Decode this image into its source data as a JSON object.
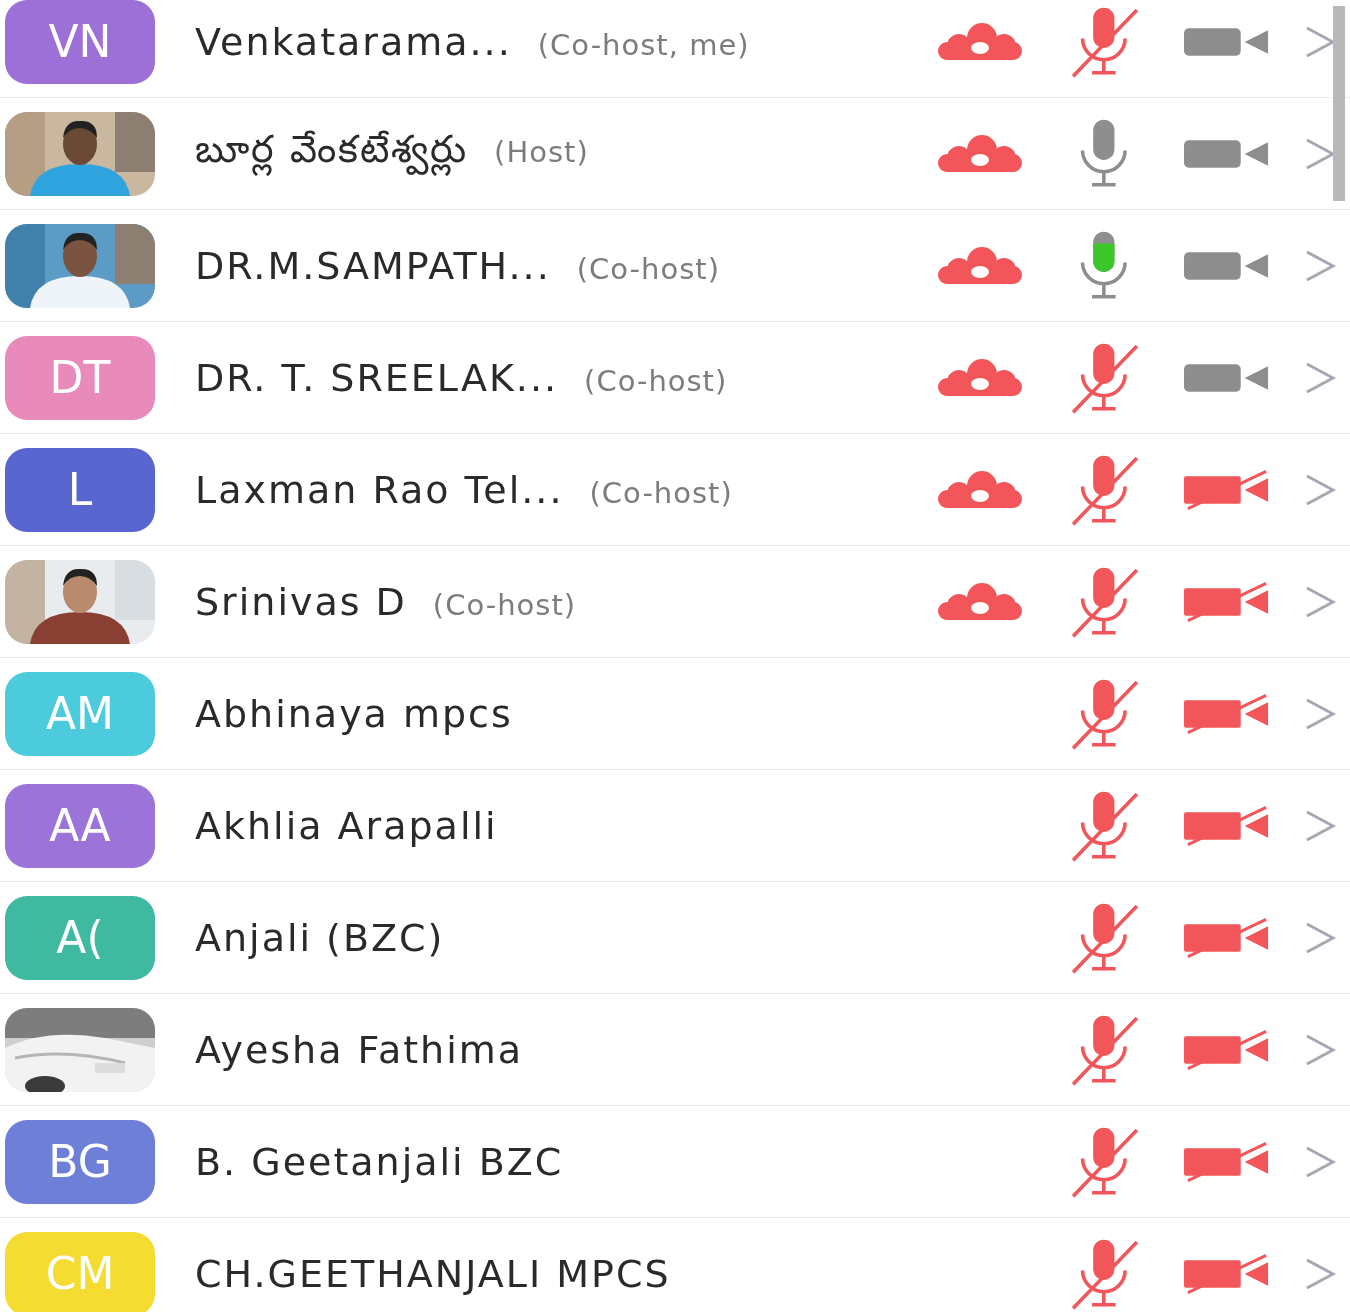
{
  "participants": [
    {
      "avatar": {
        "kind": "initials",
        "text": "VN",
        "color": "#9c70d6"
      },
      "name": "Venkatarama...",
      "role": "(Co-host, me)",
      "recording": true,
      "muted": true,
      "talking": false,
      "video_off": false
    },
    {
      "name": "బూర్ల వేంకటేశ్వర్లు",
      "role": "(Host)",
      "recording": true,
      "muted": false,
      "talking": false,
      "video_off": false
    },
    {
      "name": "DR.M.SAMPATH...",
      "role": "(Co-host)",
      "recording": true,
      "muted": false,
      "talking": true,
      "video_off": false
    },
    {
      "avatar": {
        "kind": "initials",
        "text": "DT",
        "color": "#e88bbb"
      },
      "name": "DR. T. SREELAK...",
      "role": "(Co-host)",
      "recording": true,
      "muted": true,
      "talking": false,
      "video_off": false
    },
    {
      "avatar": {
        "kind": "initials",
        "text": "L",
        "color": "#5a66cf"
      },
      "name": "Laxman Rao Tel...",
      "role": "(Co-host)",
      "recording": true,
      "muted": true,
      "talking": false,
      "video_off": true
    },
    {
      "name": "Srinivas D",
      "role": "(Co-host)",
      "recording": true,
      "muted": true,
      "talking": false,
      "video_off": true
    },
    {
      "avatar": {
        "kind": "initials",
        "text": "AM",
        "color": "#4ccbdc"
      },
      "name": "Abhinaya mpcs",
      "recording": false,
      "muted": true,
      "talking": false,
      "video_off": true
    },
    {
      "avatar": {
        "kind": "initials",
        "text": "AA",
        "color": "#9b73d9"
      },
      "name": "Akhlia Arapalli",
      "recording": false,
      "muted": true,
      "talking": false,
      "video_off": true
    },
    {
      "avatar": {
        "kind": "initials",
        "text": "A(",
        "color": "#3fb9a0"
      },
      "name": "Anjali (BZC)",
      "recording": false,
      "muted": true,
      "talking": false,
      "video_off": true
    },
    {
      "name": "Ayesha Fathima",
      "recording": false,
      "muted": true,
      "talking": false,
      "video_off": true
    },
    {
      "avatar": {
        "kind": "initials",
        "text": "BG",
        "color": "#6e7fd7"
      },
      "name": "B. Geetanjali BZC",
      "recording": false,
      "muted": true,
      "talking": false,
      "video_off": true
    },
    {
      "avatar": {
        "kind": "initials",
        "text": "CM",
        "color": "#f4dc30"
      },
      "name": "CH.GEETHANJALI MPCS",
      "recording": false,
      "muted": true,
      "talking": false,
      "video_off": true
    }
  ]
}
